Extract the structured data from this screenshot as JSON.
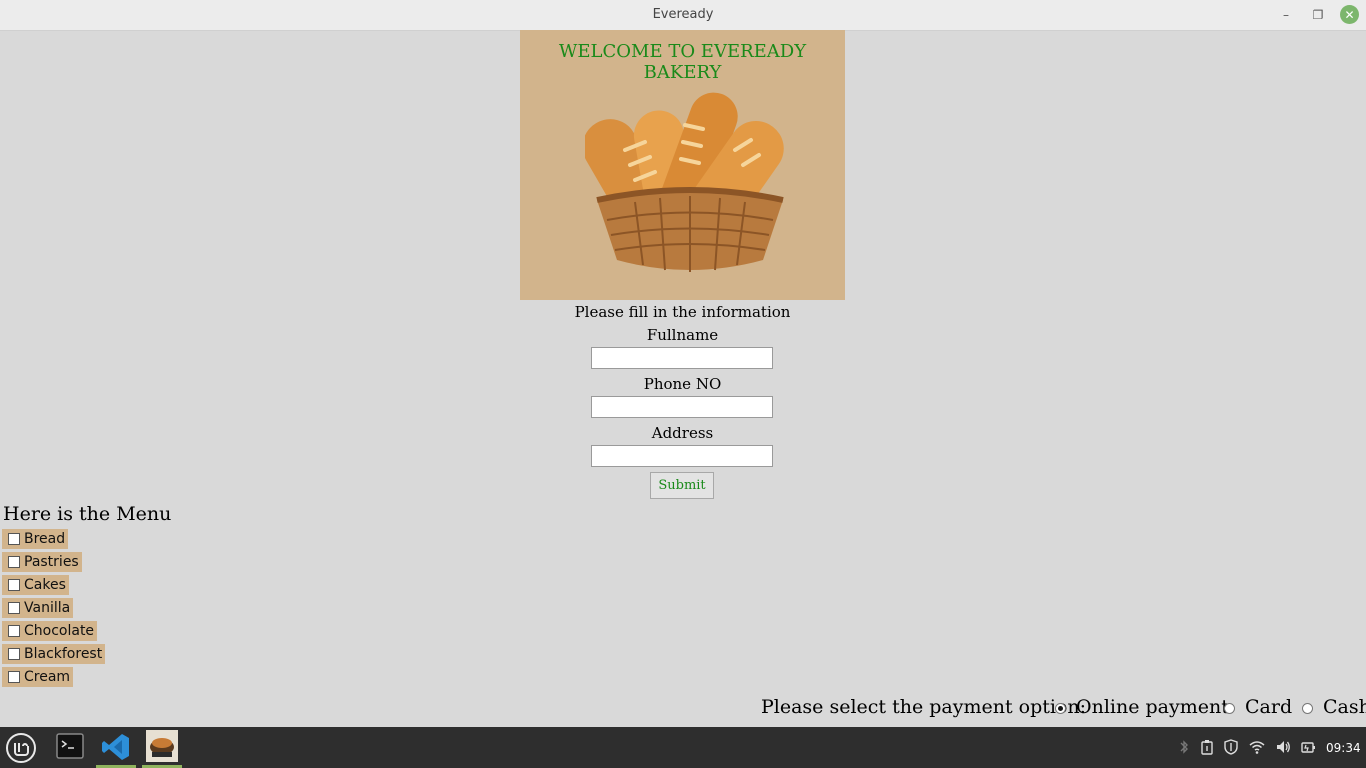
{
  "window": {
    "title": "Eveready",
    "minimize_glyph": "–",
    "maximize_glyph": "❐",
    "close_glyph": "✕"
  },
  "banner": {
    "welcome": "WELCOME TO EVEREADY BAKERY",
    "image_name": "bread-basket-image",
    "background": "#d2b48c",
    "welcome_color": "#1a8a1a"
  },
  "form": {
    "instruction": "Please fill in the information",
    "fullname_label": "Fullname",
    "fullname_value": "",
    "phone_label": "Phone NO",
    "phone_value": "",
    "address_label": "Address",
    "address_value": "",
    "submit_label": "Submit"
  },
  "menu": {
    "title": "Here is the Menu",
    "items": [
      {
        "label": "Bread",
        "checked": false
      },
      {
        "label": "Pastries",
        "checked": false
      },
      {
        "label": "Cakes",
        "checked": false
      },
      {
        "label": "Vanilla",
        "checked": false
      },
      {
        "label": "Chocolate",
        "checked": false
      },
      {
        "label": "Blackforest",
        "checked": false
      },
      {
        "label": "Cream",
        "checked": false
      }
    ]
  },
  "payment": {
    "prompt": "Please select the payment option:",
    "options": [
      {
        "label": "Online payment",
        "selected": true
      },
      {
        "label": "Card",
        "selected": false
      },
      {
        "label": "Cash",
        "selected": false
      }
    ]
  },
  "taskbar": {
    "apps": [
      "mint-menu-icon",
      "terminal-icon",
      "vscode-icon",
      "eveready-app-icon"
    ],
    "tray": [
      "bluetooth-icon",
      "clipboard-icon",
      "shield-icon",
      "wifi-icon",
      "volume-icon",
      "battery-icon"
    ],
    "clock": "09:34",
    "accent": "#8fb35d"
  }
}
